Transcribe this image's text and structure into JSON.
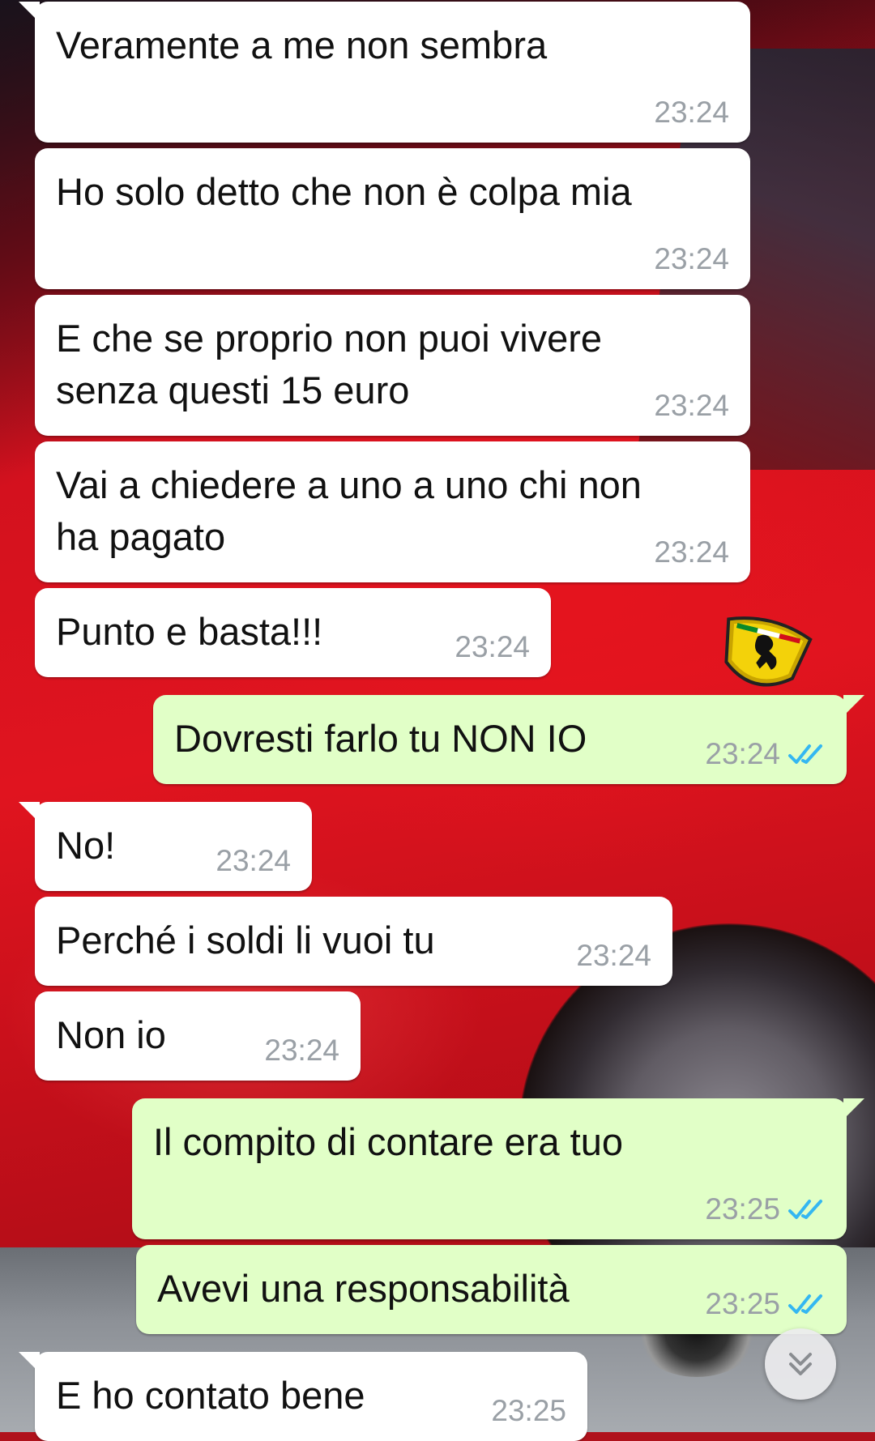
{
  "wallpaper": {
    "subject": "red-sports-car",
    "badge_icon": "prancing-horse-shield-icon"
  },
  "colors": {
    "incoming": "#ffffff",
    "outgoing": "#e1ffc7",
    "timestamp": "#9aa0a6",
    "read_tick": "#34b7f1"
  },
  "messages": [
    {
      "dir": "in",
      "text": "Veramente a me non sembra",
      "time": "23:24"
    },
    {
      "dir": "in",
      "text": "Ho solo detto che non è colpa mia",
      "time": "23:24"
    },
    {
      "dir": "in",
      "text": "E che se proprio non puoi vivere\nsenza questi 15 euro",
      "time": "23:24"
    },
    {
      "dir": "in",
      "text": "Vai a chiedere a uno a uno chi non\nha pagato",
      "time": "23:24"
    },
    {
      "dir": "in",
      "text": "Punto e basta!!!",
      "time": "23:24"
    },
    {
      "dir": "out",
      "text": "Dovresti farlo tu NON IO",
      "time": "23:24",
      "status": "read"
    },
    {
      "dir": "in",
      "text": "No!",
      "time": "23:24"
    },
    {
      "dir": "in",
      "text": "Perché i soldi li vuoi tu",
      "time": "23:24"
    },
    {
      "dir": "in",
      "text": "Non io",
      "time": "23:24"
    },
    {
      "dir": "out",
      "text": "Il compito di contare era tuo",
      "time": "23:25",
      "status": "read"
    },
    {
      "dir": "out",
      "text": "Avevi una responsabilità",
      "time": "23:25",
      "status": "read"
    },
    {
      "dir": "in",
      "text": "E ho contato bene",
      "time": "23:25"
    }
  ],
  "scroll_button": {
    "icon": "double-chevron-down-icon"
  }
}
